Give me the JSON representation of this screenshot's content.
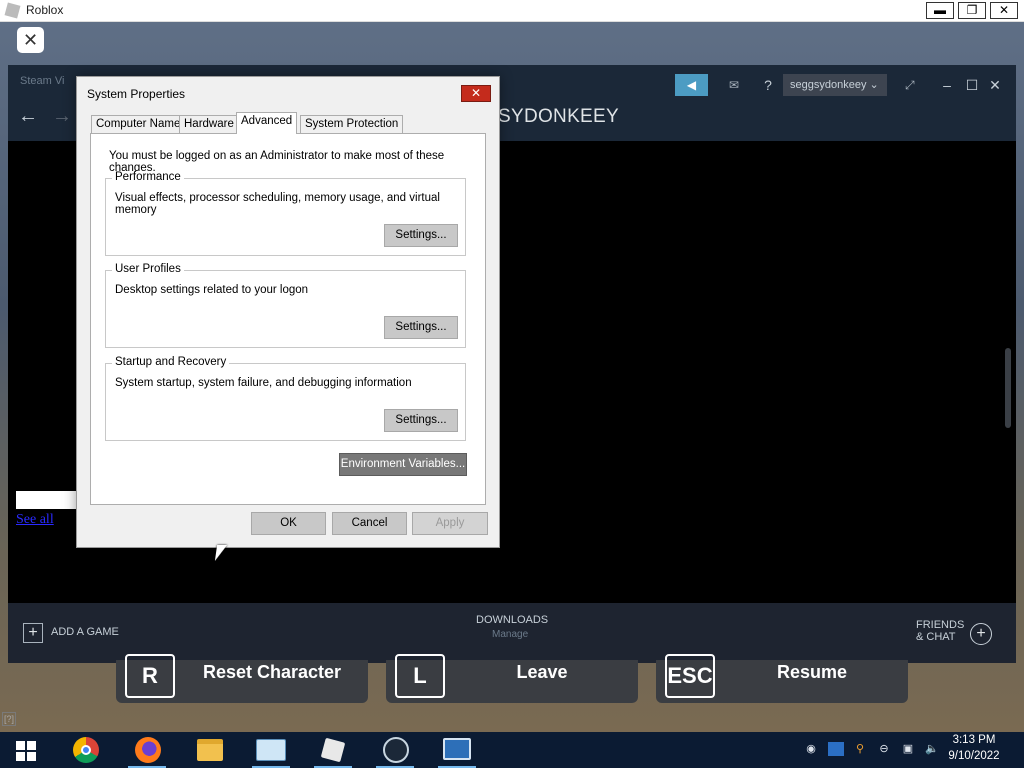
{
  "roblox": {
    "window_title": "Roblox",
    "minimize": "▬",
    "restore": "❐",
    "close": "✕",
    "overlay_close": "✕",
    "help": "[?]",
    "menu_buttons": [
      {
        "key": "R",
        "label": "Reset Character"
      },
      {
        "key": "L",
        "label": "Leave"
      },
      {
        "key": "ESC",
        "label": "Resume"
      }
    ]
  },
  "steam": {
    "menu_text": "Steam   Vi",
    "username": "seggsydonkeey ⌄",
    "profile_name": "SYDONKEEY",
    "help_glyph": "?",
    "see_all": "See all",
    "add_game": "ADD A GAME",
    "downloads": "DOWNLOADS",
    "downloads_sub": "Manage",
    "friends_line1": "FRIENDS",
    "friends_line2": "& CHAT"
  },
  "dialog": {
    "title": "System Properties",
    "tabs": [
      "Computer Name",
      "Hardware",
      "Advanced",
      "System Protection"
    ],
    "active_tab": "Advanced",
    "admin_note": "You must be logged on as an Administrator to make most of these changes.",
    "groups": [
      {
        "title": "Performance",
        "description": "Visual effects, processor scheduling, memory usage, and virtual memory",
        "button": "Settings..."
      },
      {
        "title": "User Profiles",
        "description": "Desktop settings related to your logon",
        "button": "Settings..."
      },
      {
        "title": "Startup and Recovery",
        "description": "System startup, system failure, and debugging information",
        "button": "Settings..."
      }
    ],
    "env_button": "Environment Variables...",
    "ok": "OK",
    "cancel": "Cancel",
    "apply": "Apply"
  },
  "taskbar": {
    "apps": [
      "windows-start",
      "chrome",
      "firefox",
      "file-explorer",
      "performance-monitor",
      "roblox",
      "steam",
      "remote-desktop"
    ],
    "time": "3:13 PM",
    "date": "9/10/2022"
  },
  "colors": {
    "steam_accent": "#4c9cc3",
    "dialog_close": "#c42b1c",
    "taskbar": "#0b1b33"
  }
}
